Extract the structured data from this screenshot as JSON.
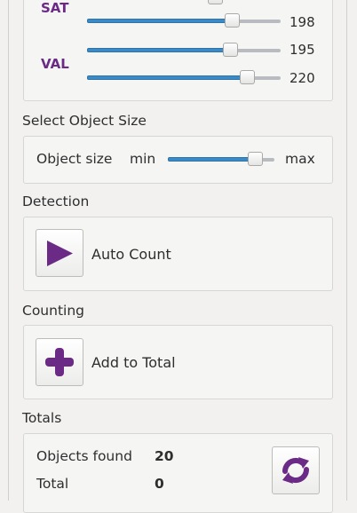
{
  "hsv": {
    "sat_label": "SAT",
    "val_label": "VAL",
    "sat_partial_value": "170",
    "sat_value": "198",
    "val_min_value": "195",
    "val_max_value": "220"
  },
  "size": {
    "title": "Select Object Size",
    "label": "Object size",
    "min_label": "min",
    "max_label": "max"
  },
  "detection": {
    "title": "Detection",
    "button_label": "Auto Count",
    "icon": "play-icon"
  },
  "counting": {
    "title": "Counting",
    "button_label": "Add to Total",
    "icon": "plus-icon"
  },
  "totals": {
    "title": "Totals",
    "objects_found_label": "Objects found",
    "objects_found_value": "20",
    "total_label": "Total",
    "total_value": "0",
    "icon": "refresh-icon"
  },
  "colors": {
    "accent_purple": "#6a2a86",
    "slider_blue": "#3a8ac8"
  }
}
